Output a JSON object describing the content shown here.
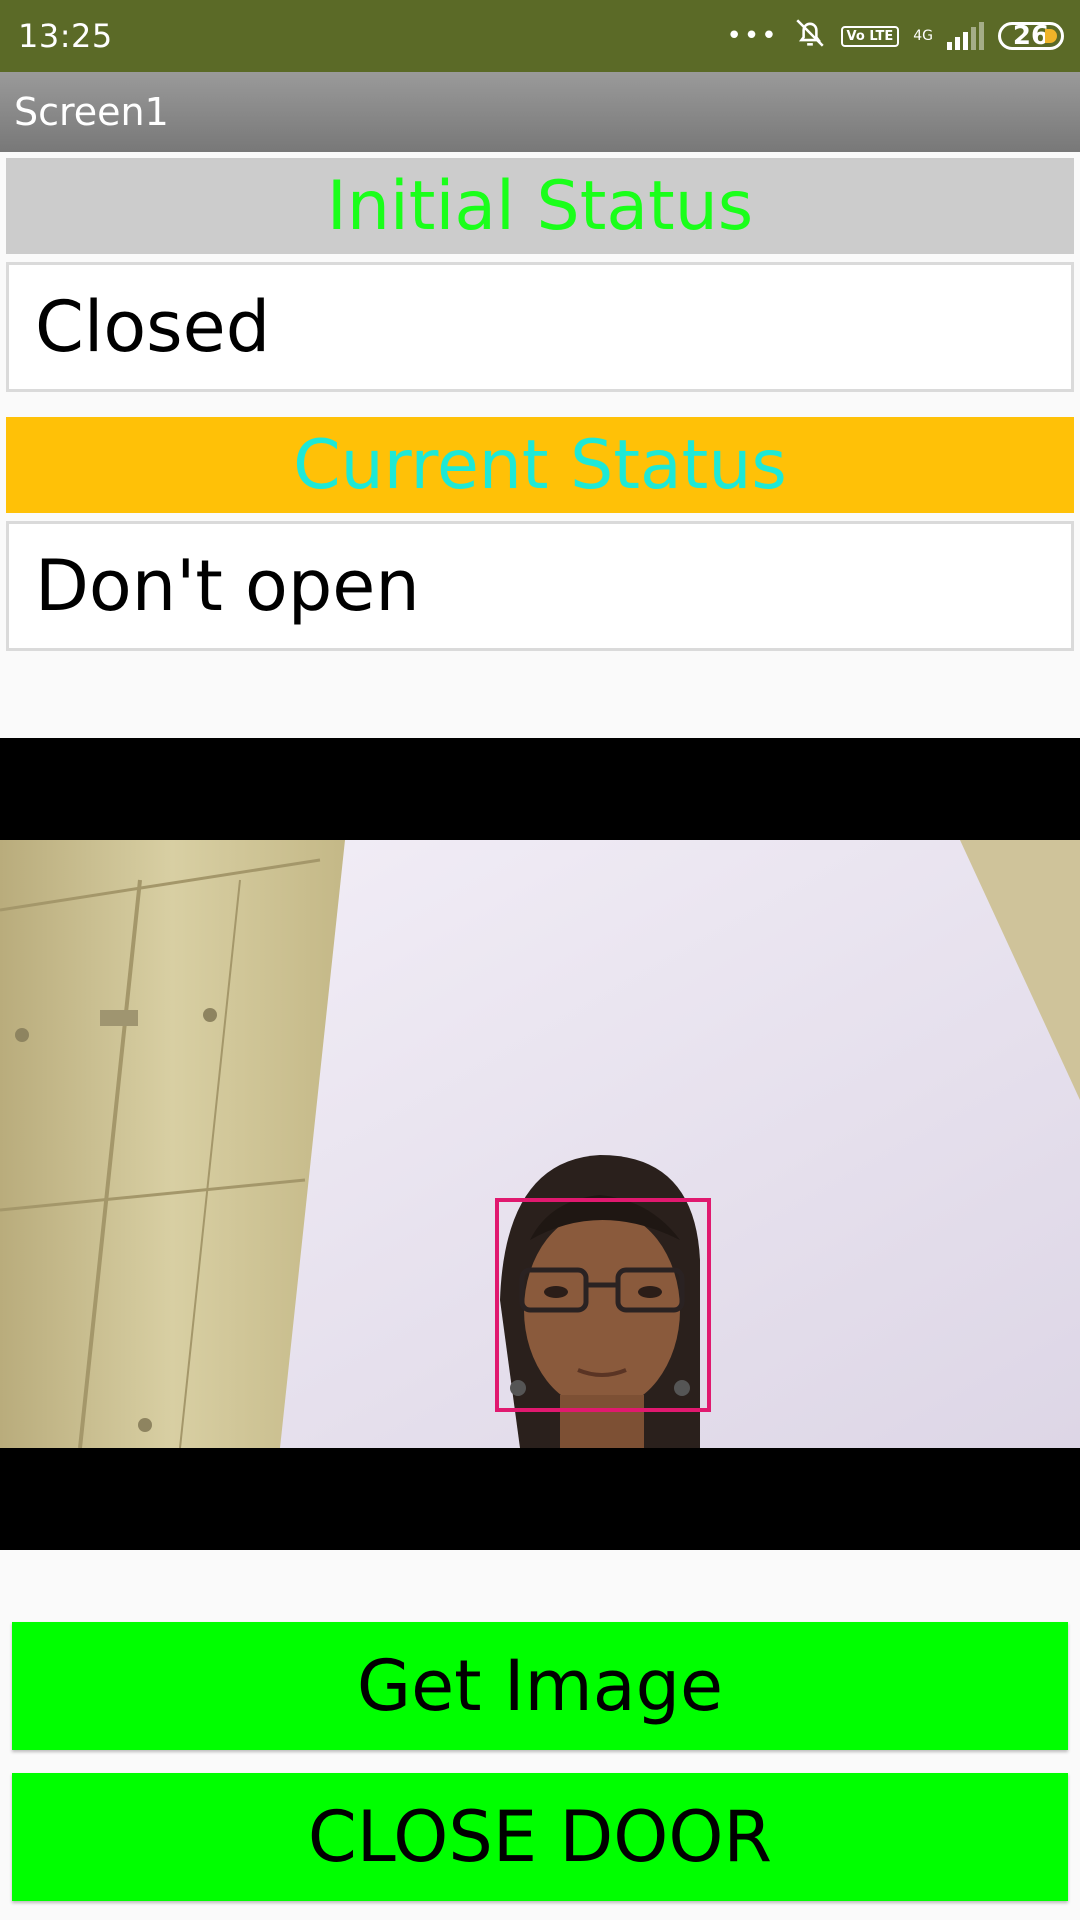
{
  "status_bar": {
    "time": "13:25",
    "dots": "•••",
    "volte": "Vo LTE",
    "network": "4G",
    "battery": "26",
    "icons": [
      "silent-bell-icon",
      "volte-icon",
      "signal-icon",
      "battery-icon"
    ]
  },
  "app_bar": {
    "title": "Screen1"
  },
  "initial_status": {
    "label": "Initial Status",
    "value": "Closed"
  },
  "current_status": {
    "label": "Current Status",
    "value": "Don't open"
  },
  "buttons": {
    "get_image": "Get Image",
    "close_door": "CLOSE DOOR"
  },
  "colors": {
    "status_bar": "#5b6a27",
    "initial_label_bg": "#cccccc",
    "initial_label_text": "#1aff1a",
    "current_label_bg": "#ffc107",
    "current_label_text": "#1de9d6",
    "button_bg": "#00ff00",
    "face_box": "#e0196f"
  }
}
